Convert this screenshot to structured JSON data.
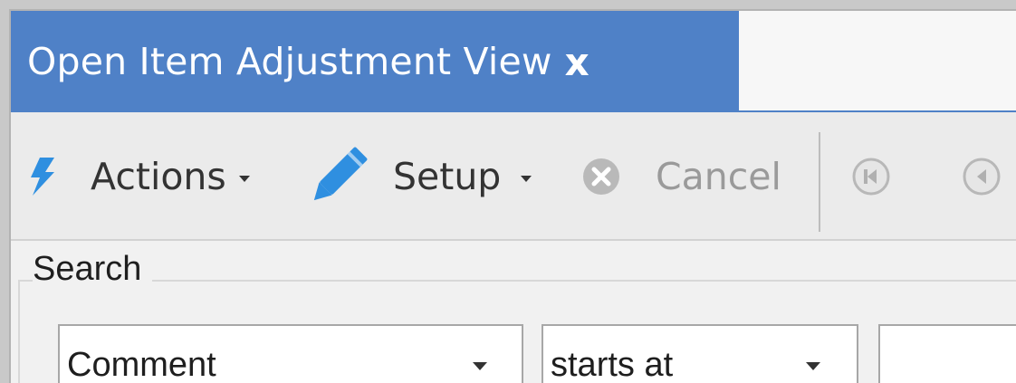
{
  "tab": {
    "title": "Open Item Adjustment View",
    "close_label": "x"
  },
  "toolbar": {
    "actions_label": "Actions",
    "setup_label": "Setup",
    "cancel_label": "Cancel",
    "icons": [
      "lightning-icon",
      "pencil-icon",
      "cancel-icon",
      "first-record-icon",
      "previous-record-icon"
    ]
  },
  "search": {
    "legend": "Search",
    "field_value": "Comment",
    "operator_value": "starts at",
    "value": ""
  },
  "colors": {
    "accent": "#4f81c7",
    "icon_blue": "#2f8fe0",
    "toolbar_bg": "#ebebeb"
  }
}
